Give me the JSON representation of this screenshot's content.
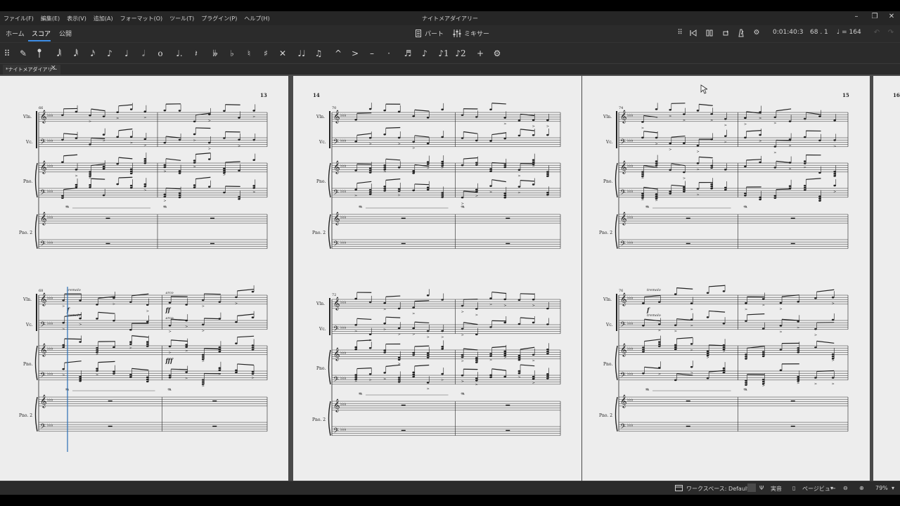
{
  "menubar": {
    "items": [
      "ファイル(F)",
      "編集(E)",
      "表示(V)",
      "追加(A)",
      "フォーマット(O)",
      "ツール(T)",
      "プラグイン(P)",
      "ヘルプ(H)"
    ],
    "title": "ナイトメアダイアリー"
  },
  "tabs": {
    "home": "ホーム",
    "score": "スコア",
    "publish": "公開",
    "parts": "パート",
    "mixer": "ミキサー"
  },
  "playback": {
    "time": "0:01:40:3",
    "position": "68 . 1",
    "tempo": "♩ = 164"
  },
  "palette": {
    "icons": [
      "grip-icon",
      "pencil-icon",
      "input-mode-icon",
      "64th-note-icon",
      "32nd-note-icon",
      "16th-note-icon",
      "eighth-note-icon",
      "quarter-note-icon",
      "half-note-icon",
      "whole-note-icon",
      "dot-icon",
      "rest-icon",
      "double-flat-icon",
      "flat-icon",
      "natural-icon",
      "sharp-icon",
      "double-sharp-icon",
      "tie-icon",
      "slur-icon",
      "marcato-icon",
      "accent-icon",
      "tenuto-icon",
      "staccato-icon",
      "tuplet-icon",
      "flip-icon",
      "voice1-icon",
      "voice2-icon",
      "add-icon",
      "settings-icon"
    ]
  },
  "document": {
    "tab_title": "*ナイトメアダイアリー"
  },
  "score": {
    "page_numbers": [
      "13",
      "14",
      "15",
      "16"
    ],
    "system_start_measures": [
      "66",
      "70",
      "74",
      "68",
      "72",
      "76"
    ],
    "instruments": {
      "violin": "Vln.",
      "cello": "Vc.",
      "piano": "Pno.",
      "piano2": "Pno. 2"
    },
    "text_marks": {
      "tremolo": "tremolo",
      "arco": "arco",
      "forte": "f",
      "fortissimo": "ff",
      "fff": "fff"
    }
  },
  "statusbar": {
    "workspace": "ワークスペース: Default",
    "concert_pitch": "実音",
    "view_mode": "ページビュー",
    "zoom": "79%"
  }
}
